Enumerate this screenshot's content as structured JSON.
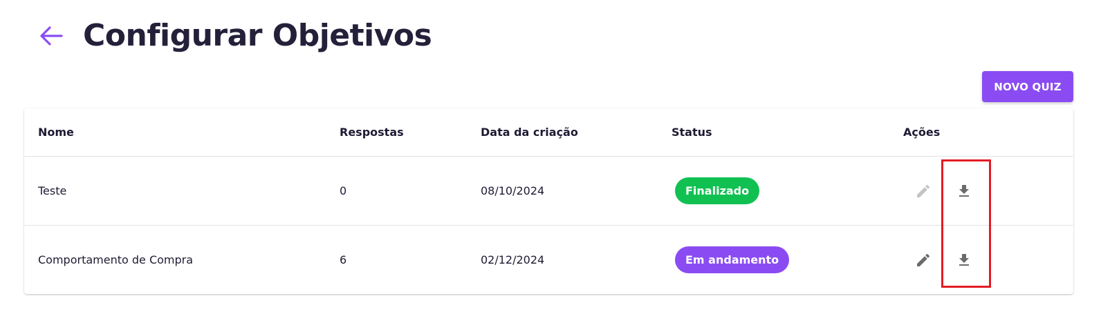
{
  "page": {
    "title": "Configurar Objetivos"
  },
  "actions": {
    "new_quiz_label": "NOVO QUIZ"
  },
  "table": {
    "columns": [
      "Nome",
      "Respostas",
      "Data da criação",
      "Status",
      "Ações"
    ],
    "rows": [
      {
        "nome": "Teste",
        "respostas": "0",
        "data": "08/10/2024",
        "status": "Finalizado",
        "status_color": "#10c152",
        "edit_enabled": false
      },
      {
        "nome": "Comportamento de Compra",
        "respostas": "6",
        "data": "02/12/2024",
        "status": "Em andamento",
        "status_color": "#8a4cf2",
        "edit_enabled": true
      }
    ]
  },
  "icons": {
    "back": "arrow-left-icon",
    "edit": "pencil-icon",
    "download": "download-icon"
  },
  "colors": {
    "accent": "#8a4cf2",
    "success": "#10c152",
    "highlight": "#e21b23",
    "title": "#25203a"
  }
}
